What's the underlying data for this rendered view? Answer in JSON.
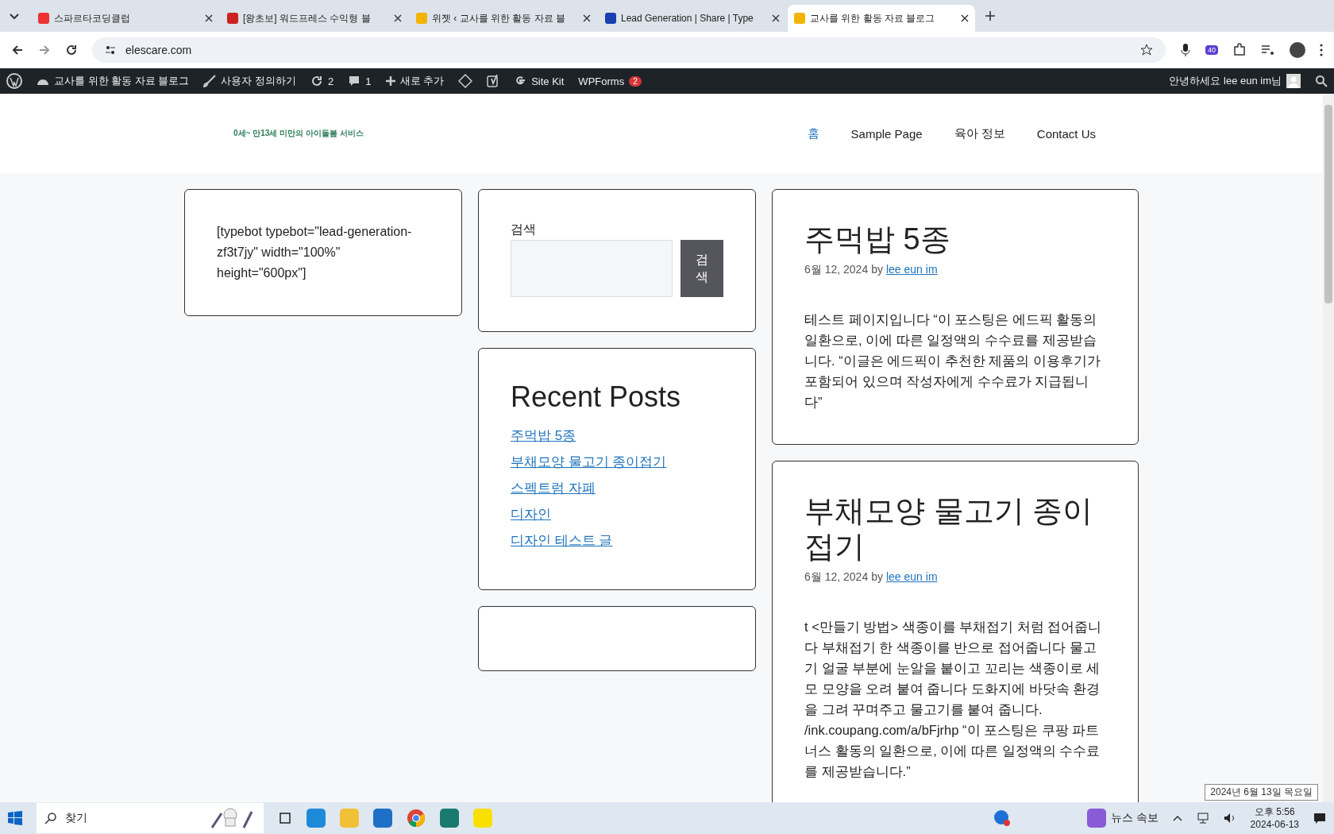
{
  "browser": {
    "tabs": [
      {
        "title": "스파르타코딩클럽",
        "selected": false
      },
      {
        "title": "[왕초보] 워드프레스 수익형 블",
        "selected": false
      },
      {
        "title": "위젯 ‹ 교사를 위한 활동 자료 블",
        "selected": false
      },
      {
        "title": "Lead Generation | Share | Type",
        "selected": false
      },
      {
        "title": "교사를 위한 활동 자료 블로그",
        "selected": true
      }
    ],
    "url": "elescare.com",
    "extension_badge": "40"
  },
  "admin_bar": {
    "site_name": "교사를 위한 활동 자료 블로그",
    "customize": "사용자 정의하기",
    "updates": "2",
    "comments": "1",
    "new": "새로 추가",
    "site_kit": "Site Kit",
    "wpforms": "WPForms",
    "wpforms_count": "2",
    "greeting": "안녕하세요 lee eun im님"
  },
  "header": {
    "logo_text": "0세~ 만13세 미만의 아이돌봄 서비스",
    "nav": [
      {
        "label": "홈",
        "selected": true
      },
      {
        "label": "Sample Page",
        "selected": false
      },
      {
        "label": "육아 정보",
        "selected": false
      },
      {
        "label": "Contact Us",
        "selected": false
      }
    ]
  },
  "shortcode_widget": {
    "text": "[typebot typebot=\"lead-generation-zf3t7jy\" width=\"100%\" height=\"600px\"]"
  },
  "search_widget": {
    "label": "검색",
    "button": "검색"
  },
  "recent_posts": {
    "title": "Recent Posts",
    "items": [
      "주먹밥 5종",
      "부채모양 물고기 종이접기",
      "스펙트럼 자폐",
      "디자인",
      "디자인 테스트 글"
    ]
  },
  "posts": [
    {
      "title": "주먹밥 5종",
      "date": "6월 12, 2024",
      "by": "by",
      "author": "lee eun im",
      "excerpt": "테스트 페이지입니다   “이 포스팅은 에드픽 활동의 일환으로, 이에 따른 일정액의 수수료를 제공받습니다.   “이글은 에드픽이 추천한 제품의 이용후기가 포함되어 있으며 작성자에게 수수료가 지급됩니다”"
    },
    {
      "title": "부채모양 물고기 종이접기",
      "date": "6월 12, 2024",
      "by": "by",
      "author": "lee eun im",
      "excerpt": "t <만들기 방법> 색종이를 부채접기 처럼 접어줍니다 부채접기 한 색종이를 반으로 접어줍니다 물고기 얼굴 부분에 눈알을 붙이고 꼬리는 색종이로 세모 모양을 오려 붙여 줍니다 도화지에 바닷속 환경을 그려 꾸며주고 물고기를 붙여 줍니다. /ink.coupang.com/a/bFjrhp “이 포스팅은 쿠팡 파트너스 활동의 일환으로, 이에 따른 일정액의 수수료를 제공받습니다.”"
    }
  ],
  "taskbar": {
    "search_placeholder": "찾기",
    "news": "뉴스 속보",
    "time": "오후 5:56",
    "date": "2024-06-13",
    "date_tooltip": "2024년 6월 13일 목요일"
  }
}
